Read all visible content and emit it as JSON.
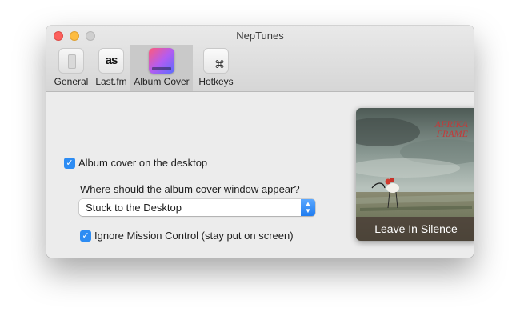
{
  "window": {
    "title": "NepTunes"
  },
  "toolbar": {
    "tabs": [
      {
        "label": "General",
        "icon": "general-switch-icon",
        "selected": false
      },
      {
        "label": "Last.fm",
        "icon": "lastfm-icon",
        "icon_text": "as",
        "selected": false
      },
      {
        "label": "Album Cover",
        "icon": "album-cover-icon",
        "selected": true
      },
      {
        "label": "Hotkeys",
        "icon": "command-key-icon",
        "icon_text": "⌘",
        "selected": false
      }
    ]
  },
  "settings": {
    "album_cover_checkbox": {
      "label": "Album cover on the desktop",
      "checked": true
    },
    "position_question": "Where should the album cover window appear?",
    "position_select": {
      "value": "Stuck to the Desktop"
    },
    "ignore_mission_control": {
      "label": "Ignore Mission Control (stay put on screen)",
      "checked": true
    }
  },
  "album_preview": {
    "band_text": "AFRIKA\nFRAME",
    "track_title": "Leave In Silence"
  },
  "colors": {
    "accent": "#2d8cf3",
    "close": "#fc605c",
    "minimize": "#fdbc40"
  }
}
